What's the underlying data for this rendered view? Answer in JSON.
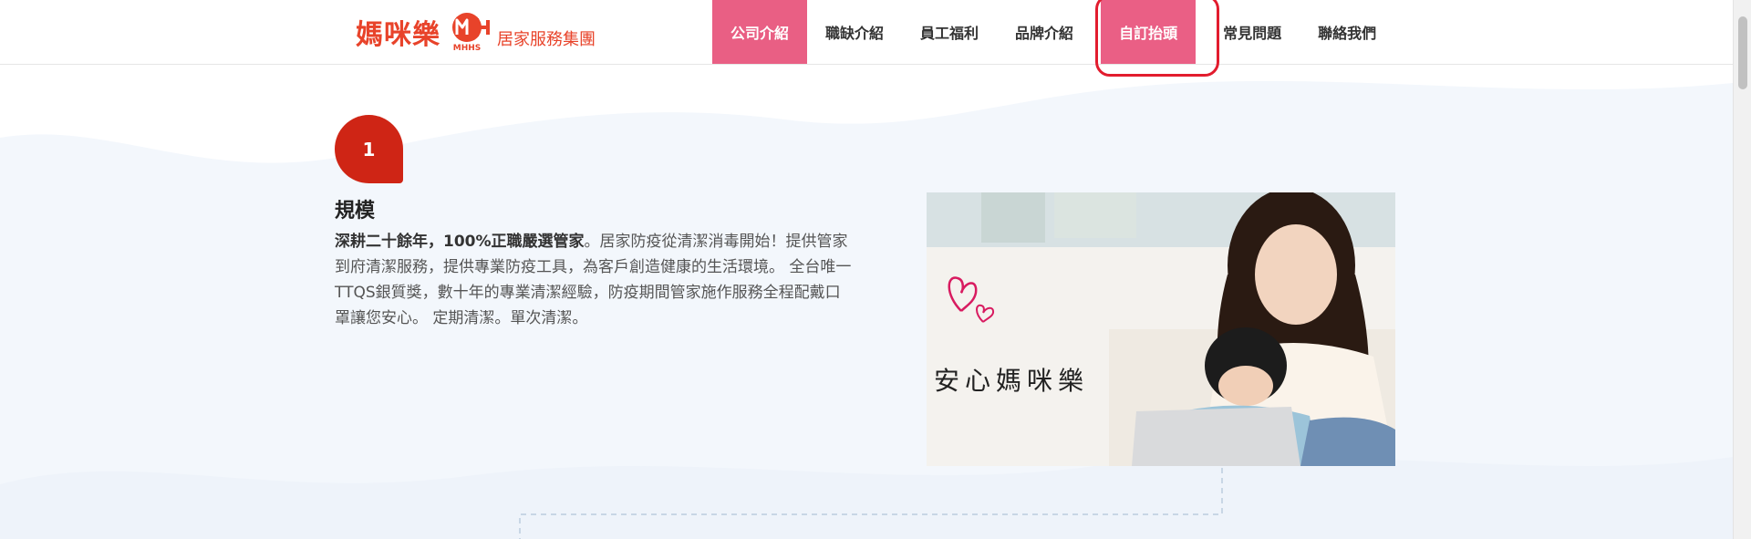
{
  "logo": {
    "name": "媽咪樂",
    "badge": "MHHS",
    "subtitle": "居家服務集團"
  },
  "nav": {
    "items": [
      {
        "label": "公司介紹",
        "state": "active"
      },
      {
        "label": "職缺介紹",
        "state": "normal"
      },
      {
        "label": "員工福利",
        "state": "normal"
      },
      {
        "label": "品牌介紹",
        "state": "normal"
      },
      {
        "label": "自訂抬頭",
        "state": "highlight"
      },
      {
        "label": "常見問題",
        "state": "normal"
      },
      {
        "label": "聯絡我們",
        "state": "normal"
      }
    ]
  },
  "section": {
    "step_number": "1",
    "title": "規模",
    "body_strong": "深耕二十餘年，100%正職嚴選管家",
    "body_text": "。居家防疫從清潔消毒開始！提供管家到府清潔服務，提供專業防疫工具，為客戶創造健康的生活環境。 全台唯一TTQS銀質獎，數十年的專業清潔經驗，防疫期間管家施作服務全程配戴口罩讓您安心。 定期清潔。單次清潔。"
  },
  "photo": {
    "caption": "安心媽咪樂"
  },
  "colors": {
    "brand_red": "#e8432a",
    "nav_pink": "#e95f84",
    "badge_red": "#cf2515",
    "annotation_red": "#e21c2e",
    "wave_blue": "#f3f7fc"
  },
  "icons": {
    "hearts": "heart-doodle-icon"
  }
}
